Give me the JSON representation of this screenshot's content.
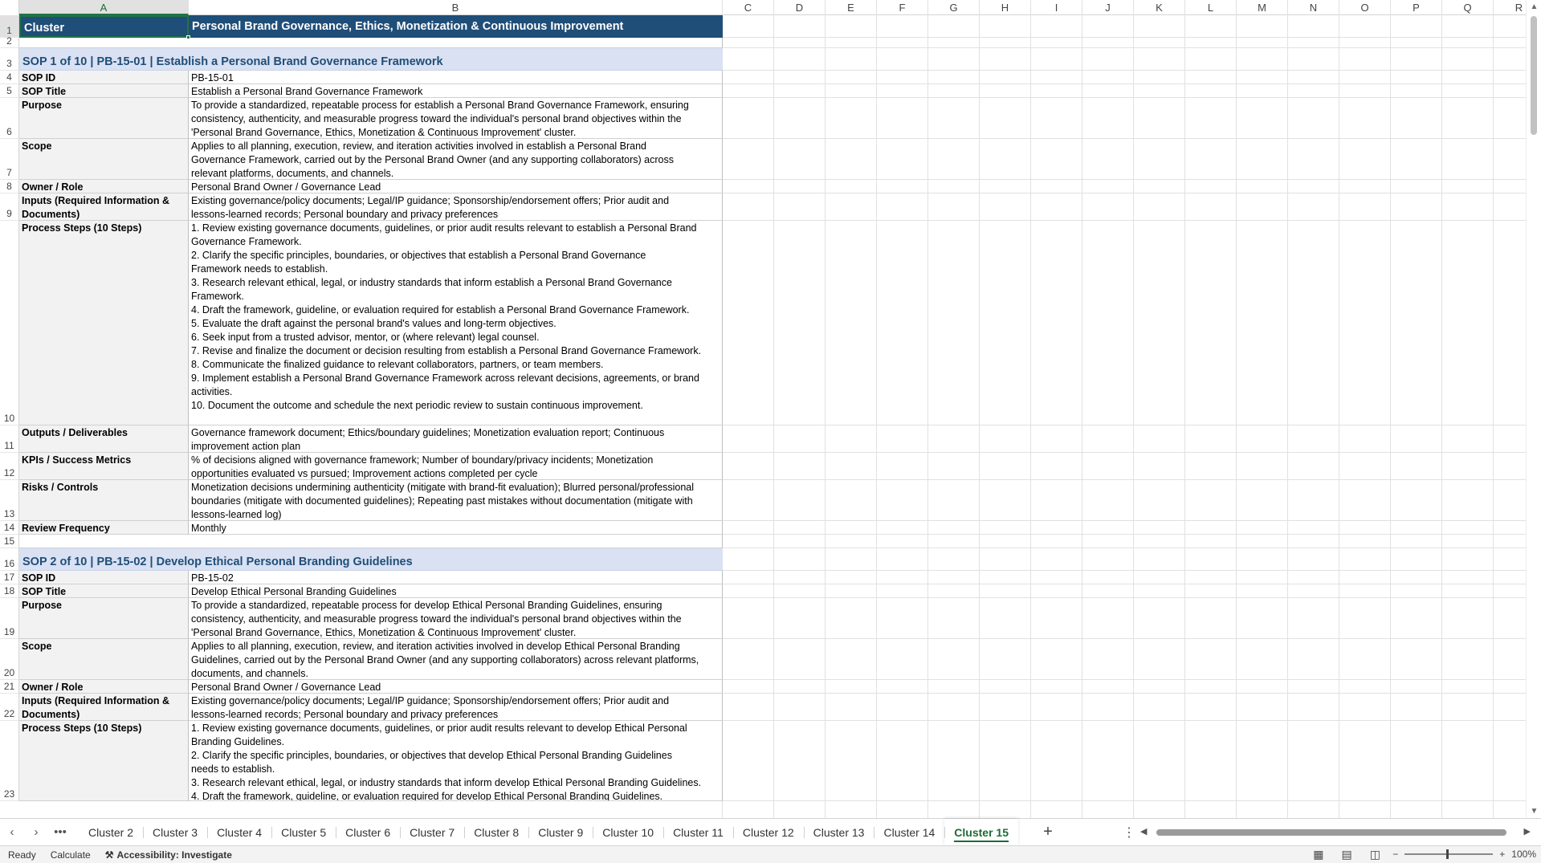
{
  "columns": [
    "A",
    "B",
    "C",
    "D",
    "E",
    "F",
    "G",
    "H",
    "I",
    "J",
    "K",
    "L",
    "M",
    "N",
    "O",
    "P",
    "Q",
    "R"
  ],
  "title_row": {
    "a": "Cluster",
    "b": "Personal Brand Governance, Ethics, Monetization & Continuous Improvement"
  },
  "sop1": {
    "header": "SOP 1 of 10  |  PB-15-01  |  Establish a Personal Brand Governance Framework",
    "rows": [
      {
        "label": "SOP ID",
        "value": "PB-15-01"
      },
      {
        "label": "SOP Title",
        "value": "Establish a Personal Brand Governance Framework"
      },
      {
        "label": "Purpose",
        "value": "To provide a standardized, repeatable process for establish a Personal Brand Governance Framework, ensuring\nconsistency, authenticity, and measurable progress toward the individual's personal brand objectives within the\n'Personal Brand Governance, Ethics, Monetization & Continuous Improvement' cluster."
      },
      {
        "label": "Scope",
        "value": "Applies to all planning, execution, review, and iteration activities involved in establish a Personal Brand\nGovernance Framework, carried out by the Personal Brand Owner (and any supporting collaborators) across\nrelevant platforms, documents, and channels."
      },
      {
        "label": "Owner / Role",
        "value": "Personal Brand Owner / Governance Lead"
      },
      {
        "label": "Inputs (Required Information & Documents)",
        "value": "Existing governance/policy documents; Legal/IP guidance; Sponsorship/endorsement offers; Prior audit and\nlessons-learned records; Personal boundary and privacy preferences"
      },
      {
        "label": "Process Steps (10 Steps)",
        "value": "1. Review existing governance documents, guidelines, or prior audit results relevant to establish a Personal Brand\nGovernance Framework.\n2. Clarify the specific principles, boundaries, or objectives that establish a Personal Brand Governance\nFramework needs to establish.\n3. Research relevant ethical, legal, or industry standards that inform establish a Personal Brand Governance\nFramework.\n4. Draft the framework, guideline, or evaluation required for establish a Personal Brand Governance Framework.\n5. Evaluate the draft against the personal brand's values and long-term objectives.\n6. Seek input from a trusted advisor, mentor, or (where relevant) legal counsel.\n7. Revise and finalize the document or decision resulting from establish a Personal Brand Governance Framework.\n8. Communicate the finalized guidance to relevant collaborators, partners, or team members.\n9. Implement establish a Personal Brand Governance Framework across relevant decisions, agreements, or brand\nactivities.\n10. Document the outcome and schedule the next periodic review to sustain continuous improvement."
      },
      {
        "label": "Outputs / Deliverables",
        "value": "Governance framework document; Ethics/boundary guidelines; Monetization evaluation report; Continuous\nimprovement action plan"
      },
      {
        "label": "KPIs / Success Metrics",
        "value": "% of decisions aligned with governance framework; Number of boundary/privacy incidents; Monetization\nopportunities evaluated vs pursued; Improvement actions completed per cycle"
      },
      {
        "label": "Risks / Controls",
        "value": "Monetization decisions undermining authenticity (mitigate with brand-fit evaluation); Blurred personal/professional\nboundaries (mitigate with documented guidelines); Repeating past mistakes without documentation (mitigate with\nlessons-learned log)"
      },
      {
        "label": "Review Frequency",
        "value": "Monthly"
      }
    ]
  },
  "sop2": {
    "header": "SOP 2 of 10  |  PB-15-02  |  Develop Ethical Personal Branding Guidelines",
    "rows": [
      {
        "label": "SOP ID",
        "value": "PB-15-02"
      },
      {
        "label": "SOP Title",
        "value": "Develop Ethical Personal Branding Guidelines"
      },
      {
        "label": "Purpose",
        "value": "To provide a standardized, repeatable process for develop Ethical Personal Branding Guidelines, ensuring\nconsistency, authenticity, and measurable progress toward the individual's personal brand objectives within the\n'Personal Brand Governance, Ethics, Monetization & Continuous Improvement' cluster."
      },
      {
        "label": "Scope",
        "value": "Applies to all planning, execution, review, and iteration activities involved in develop Ethical Personal Branding\nGuidelines, carried out by the Personal Brand Owner (and any supporting collaborators) across relevant platforms,\ndocuments, and channels."
      },
      {
        "label": "Owner / Role",
        "value": "Personal Brand Owner / Governance Lead"
      },
      {
        "label": "Inputs (Required Information & Documents)",
        "value": "Existing governance/policy documents; Legal/IP guidance; Sponsorship/endorsement offers; Prior audit and\nlessons-learned records; Personal boundary and privacy preferences"
      },
      {
        "label": "Process Steps (10 Steps)",
        "value": "1. Review existing governance documents, guidelines, or prior audit results relevant to develop Ethical Personal\nBranding Guidelines.\n2. Clarify the specific principles, boundaries, or objectives that develop Ethical Personal Branding Guidelines\nneeds to establish.\n3. Research relevant ethical, legal, or industry standards that inform develop Ethical Personal Branding Guidelines.\n4. Draft the framework, guideline, or evaluation required for develop Ethical Personal Branding Guidelines."
      }
    ]
  },
  "row_numbers": [
    "1",
    "2",
    "3",
    "4",
    "5",
    "6",
    "7",
    "8",
    "9",
    "10",
    "11",
    "12",
    "13",
    "14",
    "15",
    "16",
    "17",
    "18",
    "19",
    "20",
    "21",
    "22",
    "23"
  ],
  "tabs": [
    "Cluster 2",
    "Cluster 3",
    "Cluster 4",
    "Cluster 5",
    "Cluster 6",
    "Cluster 7",
    "Cluster 8",
    "Cluster 9",
    "Cluster 10",
    "Cluster 11",
    "Cluster 12",
    "Cluster 13",
    "Cluster 14",
    "Cluster 15"
  ],
  "active_tab": "Cluster 15",
  "status": {
    "ready": "Ready",
    "calculate": "Calculate",
    "accessibility": "Accessibility: Investigate",
    "zoom": "100%"
  },
  "colors": {
    "title_bg": "#1f4e79",
    "sop_bg": "#d9e1f2",
    "accent": "#217346"
  }
}
